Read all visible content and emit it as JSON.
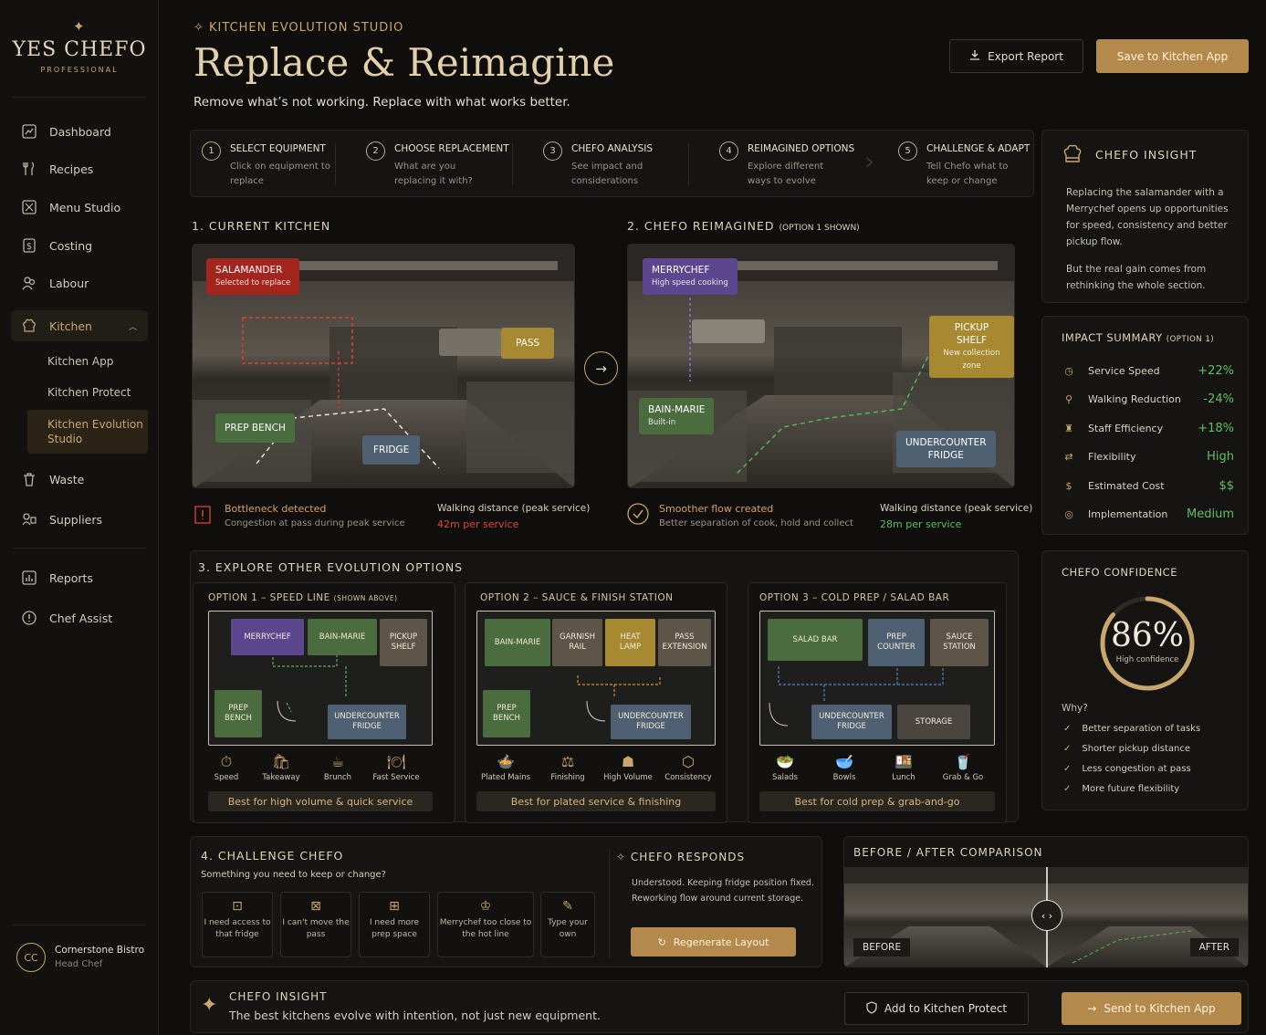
{
  "brand": {
    "name": "YES CHEFO",
    "sub": "PROFESSIONAL"
  },
  "nav": {
    "items": [
      {
        "label": "Dashboard",
        "icon": "chart-icon"
      },
      {
        "label": "Recipes",
        "icon": "utensils-icon"
      },
      {
        "label": "Menu Studio",
        "icon": "menu-icon"
      },
      {
        "label": "Costing",
        "icon": "dollar-icon"
      },
      {
        "label": "Labour",
        "icon": "people-icon"
      },
      {
        "label": "Kitchen",
        "icon": "chef-hat-icon"
      },
      {
        "label": "Waste",
        "icon": "bin-icon"
      },
      {
        "label": "Suppliers",
        "icon": "truck-icon"
      },
      {
        "label": "Reports",
        "icon": "report-icon"
      },
      {
        "label": "Chef Assist",
        "icon": "info-icon"
      }
    ],
    "kitchen_sub": [
      "Kitchen App",
      "Kitchen Protect",
      "Kitchen Evolution Studio"
    ]
  },
  "user": {
    "initials": "CC",
    "name": "Cornerstone Bistro",
    "role": "Head Chef"
  },
  "header": {
    "eyebrow": "KITCHEN EVOLUTION STUDIO",
    "title": "Replace & Reimagine",
    "subtitle": "Remove what’s not working. Replace with what works better.",
    "export_label": "Export Report",
    "save_label": "Save to Kitchen App"
  },
  "steps": [
    {
      "n": "1",
      "title": "SELECT EQUIPMENT",
      "desc": "Click on equipment to replace"
    },
    {
      "n": "2",
      "title": "CHOOSE REPLACEMENT",
      "desc": "What are you replacing it with?"
    },
    {
      "n": "3",
      "title": "CHEFO ANALYSIS",
      "desc": "See impact and considerations"
    },
    {
      "n": "4",
      "title": "REIMAGINED OPTIONS",
      "desc": "Explore different ways to evolve"
    },
    {
      "n": "5",
      "title": "CHALLENGE & ADAPT",
      "desc": "Tell Chefo what to keep or change"
    }
  ],
  "insight_top": {
    "title": "CHEFO INSIGHT",
    "p1": "Replacing the salamander with a Merrychef opens up opportunities for speed, consistency and better pickup flow.",
    "p2": "But the real gain comes from rethinking the whole section."
  },
  "current": {
    "title": "1. CURRENT KITCHEN",
    "tags": {
      "salamander": "SALAMANDER",
      "salamander_sub": "Selected to replace",
      "pass": "PASS",
      "prep": "PREP BENCH",
      "fridge": "FRIDGE"
    },
    "note_title": "Bottleneck detected",
    "note_desc": "Congestion at pass during peak service",
    "walk_label": "Walking distance (peak service)",
    "walk_value": "42m per service"
  },
  "reimagined": {
    "title": "2. CHEFO REIMAGINED",
    "title_note": "(OPTION 1 SHOWN)",
    "tags": {
      "merrychef": "MERRYCHEF",
      "merrychef_sub": "High speed cooking",
      "pickup": "PICKUP SHELF",
      "pickup_sub": "New collection zone",
      "bain": "BAIN-MARIE",
      "bain_sub": "Built-in",
      "under1": "UNDERCOUNTER",
      "under2": "FRIDGE"
    },
    "note_title": "Smoother flow created",
    "note_desc": "Better separation of cook, hold and collect",
    "walk_label": "Walking distance (peak service)",
    "walk_value": "28m per service"
  },
  "impact": {
    "title": "IMPACT SUMMARY",
    "title_note": "(OPTION 1)",
    "rows": [
      {
        "label": "Service Speed",
        "value": "+22%",
        "icon": "clock-icon"
      },
      {
        "label": "Walking Reduction",
        "value": "-24%",
        "icon": "walk-icon"
      },
      {
        "label": "Staff Efficiency",
        "value": "+18%",
        "icon": "staff-icon"
      },
      {
        "label": "Flexibility",
        "value": "High",
        "icon": "flex-icon"
      },
      {
        "label": "Estimated Cost",
        "value": "$$",
        "icon": "dollar-icon"
      },
      {
        "label": "Implementation",
        "value": "Medium",
        "icon": "target-icon"
      }
    ]
  },
  "options": {
    "title": "3. EXPLORE OTHER EVOLUTION OPTIONS",
    "list": [
      {
        "title": "OPTION 1 – SPEED LINE",
        "note": "(SHOWN ABOVE)",
        "blocks": [
          "MERRYCHEF",
          "BAIN-MARIE",
          "PICKUP SHELF",
          "PREP BENCH",
          "UNDERCOUNTER FRIDGE"
        ],
        "icons": [
          "Speed",
          "Takeaway",
          "Brunch",
          "Fast Service"
        ],
        "best": "Best for high volume & quick service"
      },
      {
        "title": "OPTION 2 – SAUCE & FINISH STATION",
        "note": "",
        "blocks": [
          "BAIN-MARIE",
          "GARNISH RAIL",
          "HEAT LAMP",
          "PASS EXTENSION",
          "PREP BENCH",
          "UNDERCOUNTER FRIDGE"
        ],
        "icons": [
          "Plated Mains",
          "Finishing",
          "High Volume",
          "Consistency"
        ],
        "best": "Best for plated service & finishing"
      },
      {
        "title": "OPTION 3 – COLD PREP / SALAD BAR",
        "note": "",
        "blocks": [
          "SALAD BAR",
          "PREP COUNTER",
          "SAUCE STATION",
          "UNDERCOUNTER FRIDGE",
          "STORAGE"
        ],
        "icons": [
          "Salads",
          "Bowls",
          "Lunch",
          "Grab & Go"
        ],
        "best": "Best for cold prep & grab-and-go"
      }
    ]
  },
  "confidence": {
    "title": "CHEFO CONFIDENCE",
    "value": "86%",
    "fraction": 0.86,
    "label": "High confidence",
    "why": "Why?",
    "reasons": [
      "Better separation of tasks",
      "Shorter pickup distance",
      "Less congestion at pass",
      "More future flexibility"
    ]
  },
  "challenge": {
    "title": "4. CHALLENGE CHEFO",
    "prompt": "Something you need to keep or change?",
    "cards": [
      "I need access to that fridge",
      "I can't move the pass",
      "I need more prep space",
      "Merrychef too close to the hot line",
      "Type your own"
    ],
    "responds_title": "CHEFO RESPONDS",
    "response": "Understood. Keeping fridge position fixed. Reworking flow around current storage.",
    "regen_label": "Regenerate Layout"
  },
  "compare": {
    "title": "BEFORE / AFTER COMPARISON",
    "before": "BEFORE",
    "after": "AFTER"
  },
  "insight_bottom": {
    "title": "CHEFO INSIGHT",
    "text": "The best kitchens evolve with intention, not just new equipment.",
    "protect_label": "Add to Kitchen Protect",
    "send_label": "Send to Kitchen App"
  }
}
